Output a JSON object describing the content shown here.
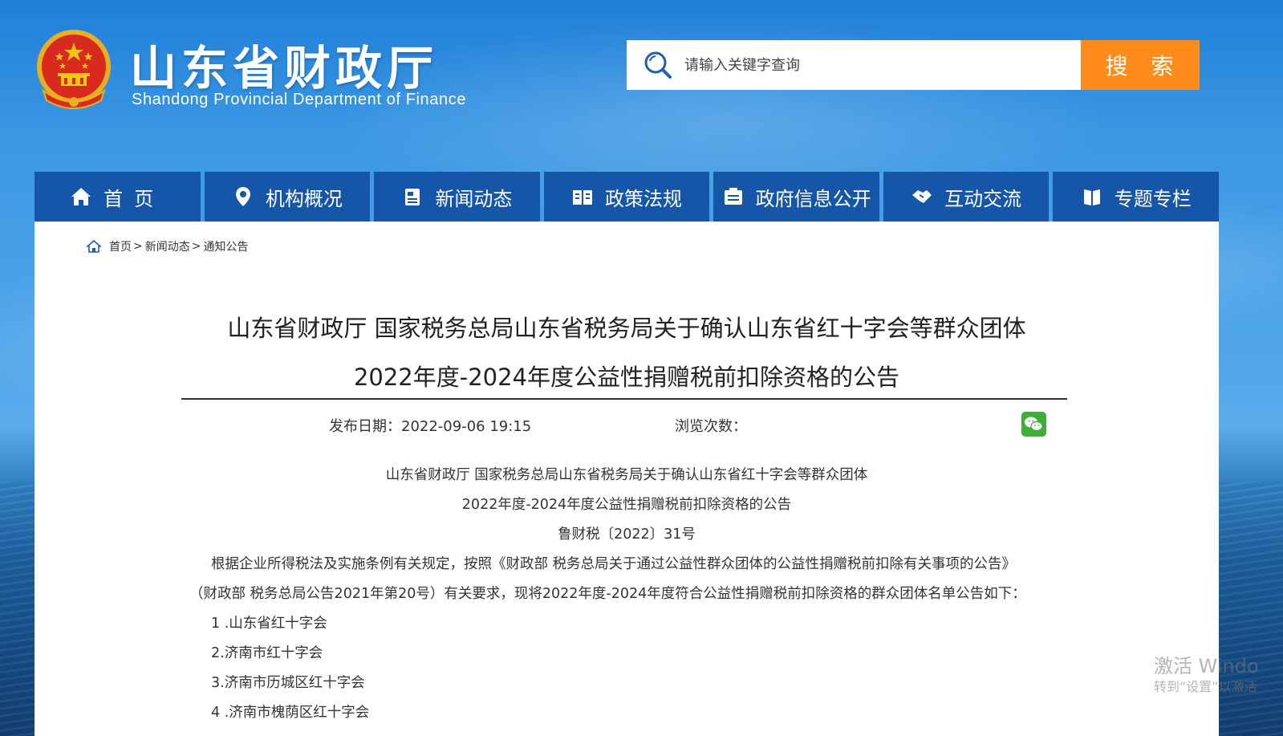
{
  "header": {
    "title": "山东省财政厅",
    "subtitle": "Shandong Provincial Department of Finance"
  },
  "search": {
    "placeholder": "请输入关键字查询",
    "button_label": "搜 索"
  },
  "nav": {
    "items": [
      {
        "label": "首页",
        "icon": "home-icon"
      },
      {
        "label": "机构概况",
        "icon": "location-pin-icon"
      },
      {
        "label": "新闻动态",
        "icon": "newspaper-icon"
      },
      {
        "label": "政策法规",
        "icon": "open-book-icon"
      },
      {
        "label": "政府信息公开",
        "icon": "folder-icon"
      },
      {
        "label": "互动交流",
        "icon": "handshake-icon"
      },
      {
        "label": "专题专栏",
        "icon": "book-icon"
      }
    ]
  },
  "breadcrumb": {
    "items": [
      "首页",
      "新闻动态",
      "通知公告"
    ],
    "separator": ">"
  },
  "article": {
    "title_line1": "山东省财政厅 国家税务总局山东省税务局关于确认山东省红十字会等群众团体",
    "title_line2": "2022年度-2024年度公益性捐赠税前扣除资格的公告",
    "publish_label": "发布日期：2022-09-06 19:15",
    "views_label": "浏览次数：",
    "body": {
      "heading1": "山东省财政厅 国家税务总局山东省税务局关于确认山东省红十字会等群众团体",
      "heading2": "2022年度-2024年度公益性捐赠税前扣除资格的公告",
      "doc_number": "鲁财税〔2022〕31号",
      "para_line1": "根据企业所得税法及实施条例有关规定，按照《财政部 税务总局关于通过公益性群众团体的公益性捐赠税前扣除有关事项的公告》",
      "para_line2": "（财政部 税务总局公告2021年第20号）有关要求，现将2022年度-2024年度符合公益性捐赠税前扣除资格的群众团体名单公告如下：",
      "list": [
        "1 .山东省红十字会",
        "2.济南市红十字会",
        "3.济南市历城区红十字会",
        "4 .济南市槐荫区红十字会"
      ]
    }
  },
  "watermark": {
    "line1": "激活 Windo",
    "line2": "转到“设置”以激活"
  },
  "colors": {
    "nav_bg": "#1556a8",
    "search_button": "#ff8c1a",
    "wechat_green": "#3cb034"
  }
}
